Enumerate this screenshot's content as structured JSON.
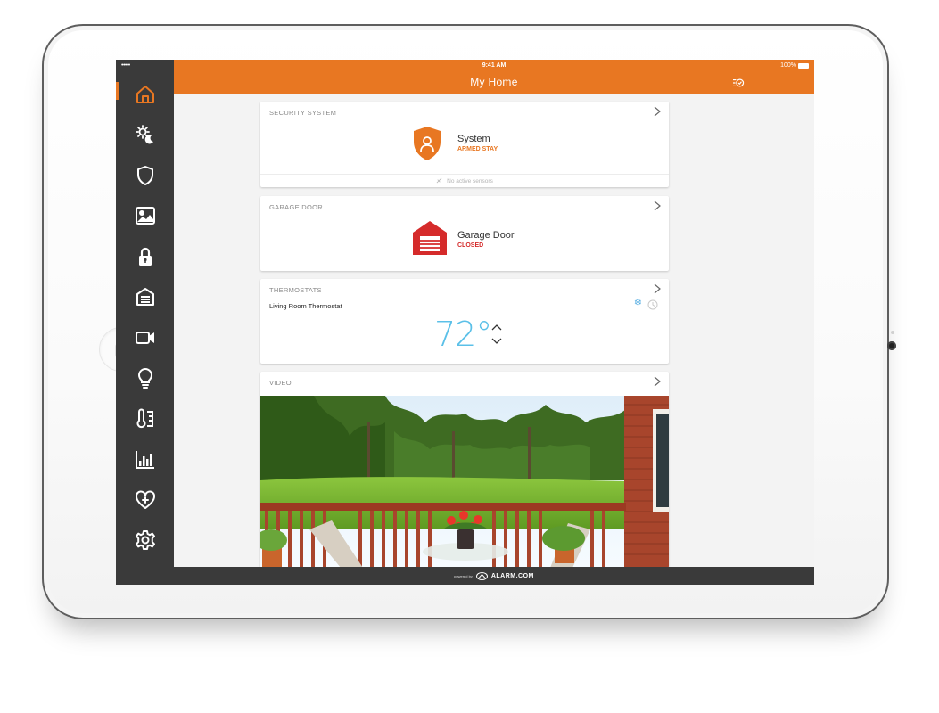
{
  "status_bar": {
    "carrier": "•••••",
    "time": "9:41 AM",
    "battery": "100%"
  },
  "header": {
    "title": "My Home"
  },
  "sidebar": {
    "items": [
      {
        "icon": "home-icon",
        "active": true
      },
      {
        "icon": "day-night-icon"
      },
      {
        "icon": "shield-icon"
      },
      {
        "icon": "image-icon"
      },
      {
        "icon": "lock-icon"
      },
      {
        "icon": "garage-icon"
      },
      {
        "icon": "video-camera-icon"
      },
      {
        "icon": "light-bulb-icon"
      },
      {
        "icon": "thermostat-icon"
      },
      {
        "icon": "bar-chart-icon"
      },
      {
        "icon": "heart-plus-icon"
      },
      {
        "icon": "gear-icon"
      }
    ],
    "accent": "#e87722",
    "background": "#3a3a3a"
  },
  "security": {
    "title": "SECURITY SYSTEM",
    "name": "System",
    "status": "ARMED STAY",
    "footer": "No active sensors"
  },
  "garage": {
    "title": "GARAGE DOOR",
    "name": "Garage Door",
    "status": "CLOSED"
  },
  "thermostats": {
    "title": "THERMOSTATS",
    "name": "Living Room Thermostat",
    "temperature": "72°"
  },
  "video": {
    "title": "VIDEO"
  },
  "footer": {
    "powered": "powered by",
    "brand": "ALARM.COM"
  },
  "colors": {
    "brand": "#e87722",
    "closed": "#d52b2b",
    "temperature": "#5bc0e8"
  }
}
